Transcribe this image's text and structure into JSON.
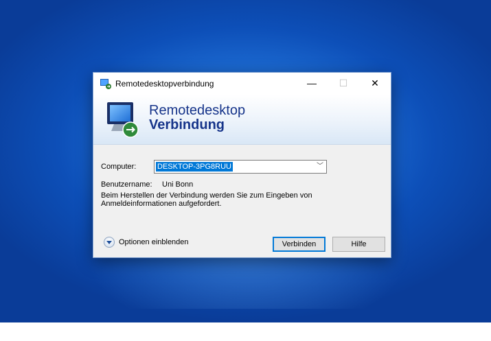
{
  "window": {
    "title": "Remotedesktopverbindung",
    "controls": {
      "minimize": "—",
      "maximize": "☐",
      "close": "✕"
    }
  },
  "banner": {
    "line1": "Remotedesktop",
    "line2": "Verbindung",
    "icon": "monitor-remote-icon"
  },
  "form": {
    "computer_label": "Computer:",
    "computer_value": "DESKTOP-3PG8RUU",
    "dropdown_glyph": "﹀",
    "username_label": "Benutzername:",
    "username_value": "Uni Bonn",
    "info_line1": "Beim Herstellen der Verbindung werden Sie zum Eingeben von",
    "info_line2": "Anmeldeinformationen aufgefordert."
  },
  "footer": {
    "options_label": "Optionen einblenden",
    "connect_label": "Verbinden",
    "help_label": "Hilfe"
  },
  "colors": {
    "accent": "#0078d7",
    "banner_text": "#16348a"
  }
}
